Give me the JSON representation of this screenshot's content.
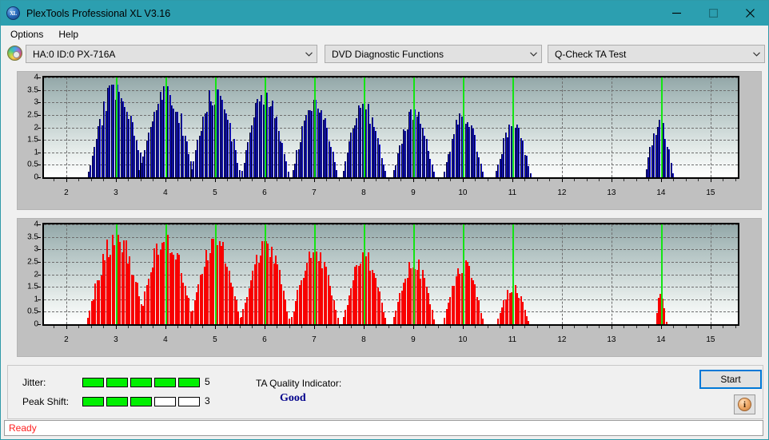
{
  "window": {
    "title": "PlexTools Professional XL V3.16",
    "app_icon": "xl-logo-icon",
    "minimize_label": "—",
    "maximize_label": "☐",
    "close_label": "✕"
  },
  "menu": {
    "items": [
      {
        "label": "Options"
      },
      {
        "label": "Help"
      }
    ]
  },
  "toolbar": {
    "drive_icon": "optical-disc-icon",
    "drive_combo": {
      "value": "HA:0 ID:0  PX-716A",
      "arrow": "⌄"
    },
    "function_combo": {
      "value": "DVD Diagnostic Functions",
      "arrow": "⌄"
    },
    "test_combo": {
      "value": "Q-Check TA Test",
      "arrow": "⌄"
    }
  },
  "bottom": {
    "jitter_label": "Jitter:",
    "jitter_value": "5",
    "jitter_filled": 5,
    "jitter_total": 5,
    "peak_shift_label": "Peak Shift:",
    "peak_shift_value": "3",
    "peak_shift_filled": 3,
    "peak_shift_total": 5,
    "tqi_label": "TA Quality Indicator:",
    "tqi_value": "Good",
    "tqi_color": "#00008b",
    "meter_on_color": "#00f000",
    "start_label": "Start",
    "info_icon": "info-icon",
    "info_glyph": "i"
  },
  "statusbar": {
    "text": "Ready",
    "color": "#ff2020"
  },
  "chart_data": [
    {
      "id": "top",
      "type": "bar",
      "title": "",
      "xlabel": "",
      "ylabel": "",
      "color": "#1818e0",
      "series_name": "Jitter (blue)",
      "ylim": [
        0,
        4
      ],
      "yticks": [
        0,
        0.5,
        1,
        1.5,
        2,
        2.5,
        3,
        3.5,
        4
      ],
      "ytick_labels": [
        "0",
        "0.5",
        "1",
        "1.5",
        "2",
        "2.5",
        "3",
        "3.5",
        "4"
      ],
      "xlim": [
        1.55,
        15.55
      ],
      "xticks": [
        2,
        3,
        4,
        5,
        6,
        7,
        8,
        9,
        10,
        11,
        12,
        13,
        14,
        15
      ],
      "xtick_labels": [
        "2",
        "3",
        "4",
        "5",
        "6",
        "7",
        "8",
        "9",
        "10",
        "11",
        "12",
        "13",
        "14",
        "15"
      ],
      "grid": true,
      "markers": [
        3,
        4,
        5,
        6,
        7,
        8,
        9,
        10,
        11,
        14
      ],
      "clusters": [
        {
          "center": 3.0,
          "peak": 3.72,
          "halfwidth": 0.6
        },
        {
          "center": 4.0,
          "peak": 3.66,
          "halfwidth": 0.58
        },
        {
          "center": 5.0,
          "peak": 3.52,
          "halfwidth": 0.52
        },
        {
          "center": 6.0,
          "peak": 3.38,
          "halfwidth": 0.5
        },
        {
          "center": 7.0,
          "peak": 3.12,
          "halfwidth": 0.48
        },
        {
          "center": 8.0,
          "peak": 2.96,
          "halfwidth": 0.46
        },
        {
          "center": 9.0,
          "peak": 2.72,
          "halfwidth": 0.44
        },
        {
          "center": 10.0,
          "peak": 2.56,
          "halfwidth": 0.42
        },
        {
          "center": 11.0,
          "peak": 2.12,
          "halfwidth": 0.38
        },
        {
          "center": 13.95,
          "peak": 2.3,
          "halfwidth": 0.3
        }
      ]
    },
    {
      "id": "bottom",
      "type": "bar",
      "title": "",
      "xlabel": "",
      "ylabel": "",
      "color": "#f80000",
      "series_name": "Peak Shift (red)",
      "ylim": [
        0,
        4
      ],
      "yticks": [
        0,
        0.5,
        1,
        1.5,
        2,
        2.5,
        3,
        3.5,
        4
      ],
      "ytick_labels": [
        "0",
        "0.5",
        "1",
        "1.5",
        "2",
        "2.5",
        "3",
        "3.5",
        "4"
      ],
      "xlim": [
        1.55,
        15.55
      ],
      "xticks": [
        2,
        3,
        4,
        5,
        6,
        7,
        8,
        9,
        10,
        11,
        12,
        13,
        14,
        15
      ],
      "xtick_labels": [
        "2",
        "3",
        "4",
        "5",
        "6",
        "7",
        "8",
        "9",
        "10",
        "11",
        "12",
        "13",
        "14",
        "15"
      ],
      "grid": true,
      "markers": [
        3,
        4,
        5,
        6,
        7,
        8,
        9,
        10,
        11,
        14
      ],
      "clusters": [
        {
          "center": 3.0,
          "peak": 3.6,
          "halfwidth": 0.62
        },
        {
          "center": 4.0,
          "peak": 3.58,
          "halfwidth": 0.58
        },
        {
          "center": 5.0,
          "peak": 3.42,
          "halfwidth": 0.54
        },
        {
          "center": 6.0,
          "peak": 3.32,
          "halfwidth": 0.52
        },
        {
          "center": 7.0,
          "peak": 3.02,
          "halfwidth": 0.5
        },
        {
          "center": 8.0,
          "peak": 2.88,
          "halfwidth": 0.46
        },
        {
          "center": 9.0,
          "peak": 2.62,
          "halfwidth": 0.44
        },
        {
          "center": 10.0,
          "peak": 2.56,
          "halfwidth": 0.42
        },
        {
          "center": 11.0,
          "peak": 1.6,
          "halfwidth": 0.34
        },
        {
          "center": 13.98,
          "peak": 1.22,
          "halfwidth": 0.12
        }
      ]
    }
  ]
}
